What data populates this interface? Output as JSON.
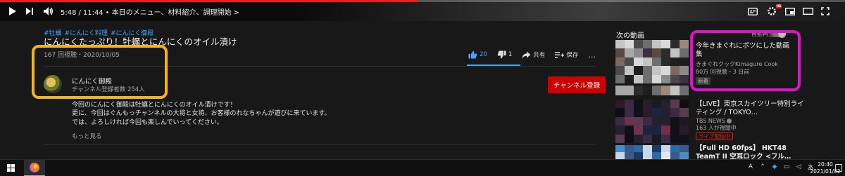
{
  "player": {
    "current_time": "5:48",
    "duration": "11:44",
    "chapter": "本日のメニュー、材料紹介、調理開始",
    "chapter_chevron": ">",
    "progress_fraction": 0.494,
    "hd_badge": "HD",
    "colors": {
      "progress": "#e62117"
    }
  },
  "video": {
    "hashtags": [
      "#牡蠣",
      "#にんにく料理",
      "#にんにく御殿"
    ],
    "title": "にんにくたっぷり！牡蠣とにんにくのオイル漬け",
    "views": "167 回視聴",
    "date": "2020/10/05",
    "like_count": "20",
    "dislike_count": "1",
    "share_label": "共有",
    "save_label": "保存",
    "more_label": "…"
  },
  "channel": {
    "name": "にんにく御殿",
    "subscribers": "チャンネル登録者数 254人",
    "subscribe_label": "チャンネル登録"
  },
  "description": {
    "lines": [
      "今回のにんにく御殿は牡蠣とにんにくのオイル漬けです！",
      "更に、今回はぐんもっチャンネルの大将と女将、お客様のれなちゃんが遊びに来ています。",
      "では、よろしければ今回も楽しんでいってください。"
    ],
    "show_more": "もっと見る"
  },
  "sidebar": {
    "up_next_label": "次の動画",
    "autoplay_label": "自動再生",
    "autoplay_on": false,
    "items": [
      {
        "title": "今年きまぐれにボツにした動画集",
        "channel": "きまぐれクックKimagure Cook",
        "meta": "80万 回視聴・3 日前",
        "badge": "新着"
      },
      {
        "title": "【LIVE】東京スカイツリー特別ライティング / TOKYO…",
        "channel": "TBS NEWS",
        "meta": "163 人が視聴中",
        "badge": "ライブ配信中"
      },
      {
        "title": "【Full HD 60fps】 HKT48 TeamT II 空耳ロック <フル…",
        "channel": "",
        "meta": "",
        "badge": ""
      }
    ]
  },
  "taskbar": {
    "time": "20:40",
    "date": "2021/01/02",
    "tray_a": "A",
    "tray_ime": "あ"
  },
  "annotations": {
    "yellow": "#f5b21b",
    "magenta": "#e012c8"
  }
}
